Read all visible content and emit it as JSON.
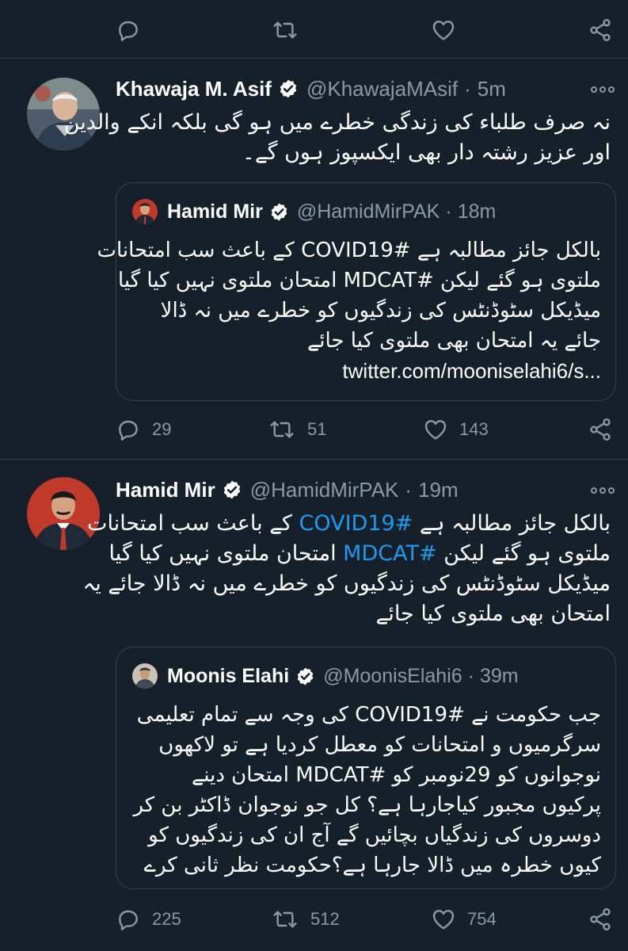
{
  "colors": {
    "background": "#15202b",
    "text": "#ffffff",
    "secondary": "#8b98a5",
    "border": "#38444d",
    "accent": "#1d9bf0"
  },
  "top_actions": {
    "reply": "",
    "retweet": "",
    "like": ""
  },
  "tweets": [
    {
      "author": "Khawaja M. Asif",
      "handle": "@KhawajaMAsif",
      "separator": "·",
      "time": "5m",
      "verified": true,
      "text_lines": [
        "نہ صرف طلباء کی زندگی خطرے میں ہو گی بلکہ انکے والدین",
        "اور عزیز رشتہ دار بھی ایکسپوز ہوں گے۔"
      ],
      "quote": {
        "author": "Hamid Mir",
        "handle": "@HamidMirPAK",
        "separator": "·",
        "time": "18m",
        "text_lines": [
          "بالکل جائز مطالبہ ہے #COVID19 کے باعث سب امتحانات",
          "ملتوی ہو گئے لیکن #MDCAT امتحان ملتوی نہیں کیا گیا",
          "میڈیکل سٹوڈنٹس کی زندگیوں کو خطرے میں نہ ڈالا",
          "جائے یہ امتحان بھی ملتوی کیا جائے"
        ],
        "link": "twitter.com/mooniselahi6/s..."
      },
      "counts": {
        "replies": "29",
        "retweets": "51",
        "likes": "143"
      }
    },
    {
      "author": "Hamid Mir",
      "handle": "@HamidMirPAK",
      "separator": "·",
      "time": "19m",
      "verified": true,
      "text_lines": [
        [
          "بالکل جائز مطالبہ ہے ",
          "#COVID19",
          " کے باعث سب امتحانات"
        ],
        [
          "ملتوی ہو گئے لیکن ",
          "#MDCAT",
          " امتحان ملتوی نہیں کیا گیا"
        ],
        [
          "میڈیکل سٹوڈنٹس کی زندگیوں کو خطرے میں نہ ڈالا جائے یہ",
          "",
          ""
        ],
        [
          "امتحان بھی ملتوی کیا جائے",
          "",
          ""
        ]
      ],
      "quote": {
        "author": "Moonis Elahi",
        "handle": "@MoonisElahi6",
        "separator": "·",
        "time": "39m",
        "text_lines": [
          "جب حکومت نے #COVID19  کی وجہ سے تمام تعلیمی",
          "سرگرمیوں و امتحانات کو معطل کردیا ہے تو لاکھوں",
          "نوجوانوں کو 29نومبر کو #MDCAT  امتحان دینے",
          "پرکیوں مجبور کیاجارہا ہے؟ کل جو نوجوان ڈاکٹر بن کر",
          "دوسروں کی زندگیاں بچائیں گے آج ان کی زندگیوں کو",
          "کیوں خطرہ میں ڈالا جارہا ہے؟حکومت نظر ثانی کرے"
        ]
      },
      "counts": {
        "replies": "225",
        "retweets": "512",
        "likes": "754"
      }
    }
  ]
}
